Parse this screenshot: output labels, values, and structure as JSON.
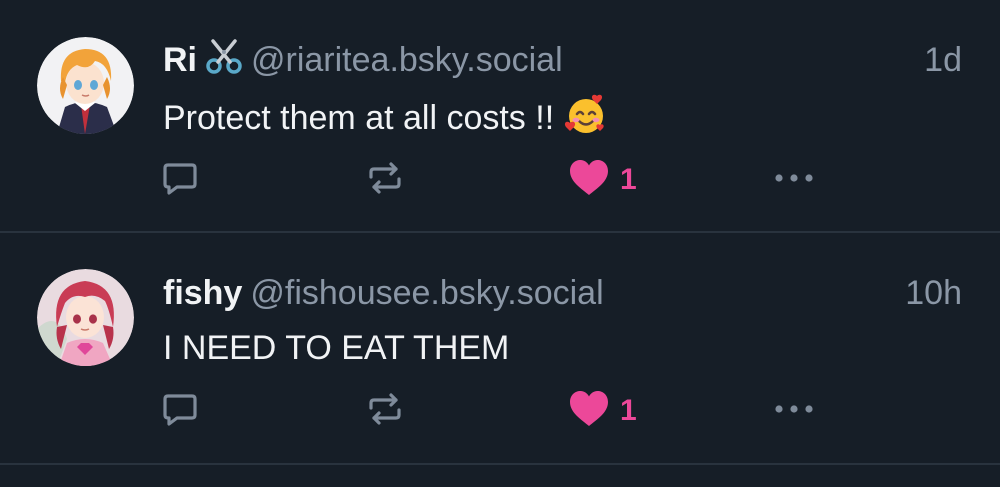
{
  "posts": [
    {
      "display_name": "Ri",
      "name_emoji_icon": "scissors-icon",
      "handle": "@riaritea.bsky.social",
      "timestamp": "1d",
      "text": "Protect them at all costs !!",
      "text_emoji_icon": "smiling-face-with-hearts-icon",
      "like_count": "1",
      "liked": true
    },
    {
      "display_name": "fishy",
      "handle": "@fishousee.bsky.social",
      "timestamp": "10h",
      "text": "I NEED TO EAT THEM",
      "like_count": "1",
      "liked": true
    }
  ],
  "colors": {
    "background": "#161e27",
    "divider": "#29333e",
    "text_primary": "#f1f3f5",
    "text_secondary": "#8b97a6",
    "icon": "#7f8b9a",
    "like": "#ec4899"
  }
}
